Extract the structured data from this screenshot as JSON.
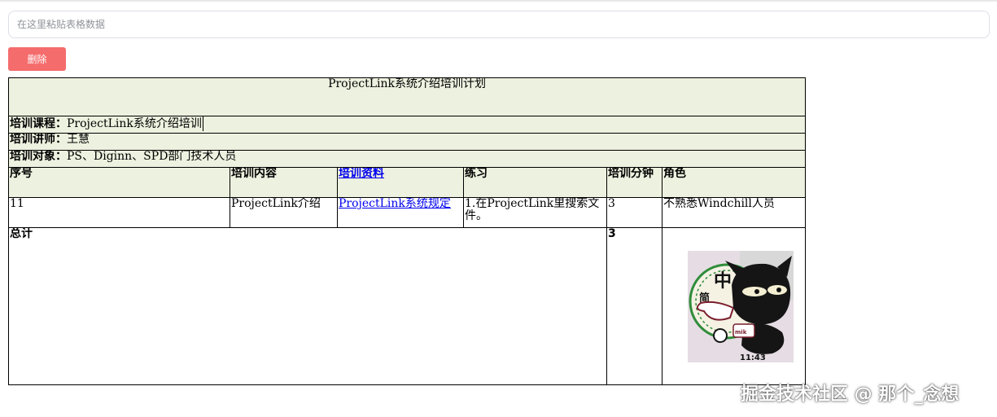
{
  "input": {
    "placeholder": "在这里粘贴表格数据"
  },
  "toolbar": {
    "delete_label": "删除"
  },
  "table": {
    "title": "ProjectLink系统介绍培训计划",
    "course_label": "培训课程：",
    "course_value": "ProjectLink系统介绍培训",
    "lecturer_label": "培训讲师：",
    "lecturer_value": "王慧",
    "audience_label": "培训对象：",
    "audience_value": "PS、Diginn、SPD部门技术人员",
    "headers": [
      "序号",
      "培训内容",
      "培训资料",
      "练习",
      "培训分钟",
      "角色"
    ],
    "row": {
      "no": "11",
      "content": "ProjectLink介绍",
      "material": "ProjectLink系统规定",
      "exercise": "1.在ProjectLink里搜索文件。",
      "minutes": "3",
      "role": "不熟悉Windchill人员"
    },
    "total_label": "总计",
    "total_minutes": "3"
  },
  "sticker": {
    "big_char": "中",
    "small_char": "简",
    "time": "11:43",
    "mark": "mik"
  },
  "watermark": "掘金技术社区 @ 那个_念想",
  "colors": {
    "header_bg": "#edf1df",
    "delete_button": "#f56c6c",
    "link": "#0000ee"
  }
}
